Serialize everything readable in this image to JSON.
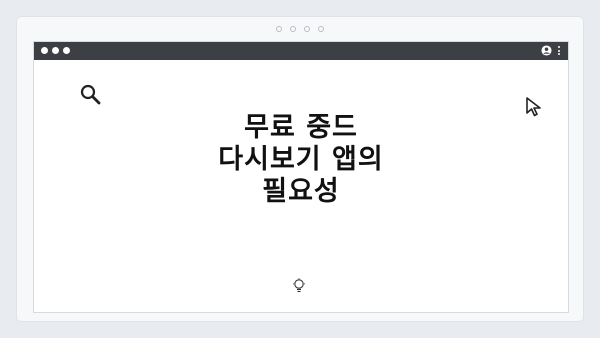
{
  "window": {
    "title_lines": [
      "무료 중드",
      "다시보기 앱의",
      "필요성"
    ]
  },
  "icons": {
    "search": "search-icon",
    "cursor": "cursor-arrow-icon",
    "bulb": "lightbulb-icon",
    "user": "user-icon",
    "menu": "kebab-menu-icon"
  },
  "colors": {
    "background": "#e8ecf0",
    "titlebar": "#3c3f43",
    "headline": "#111111"
  }
}
